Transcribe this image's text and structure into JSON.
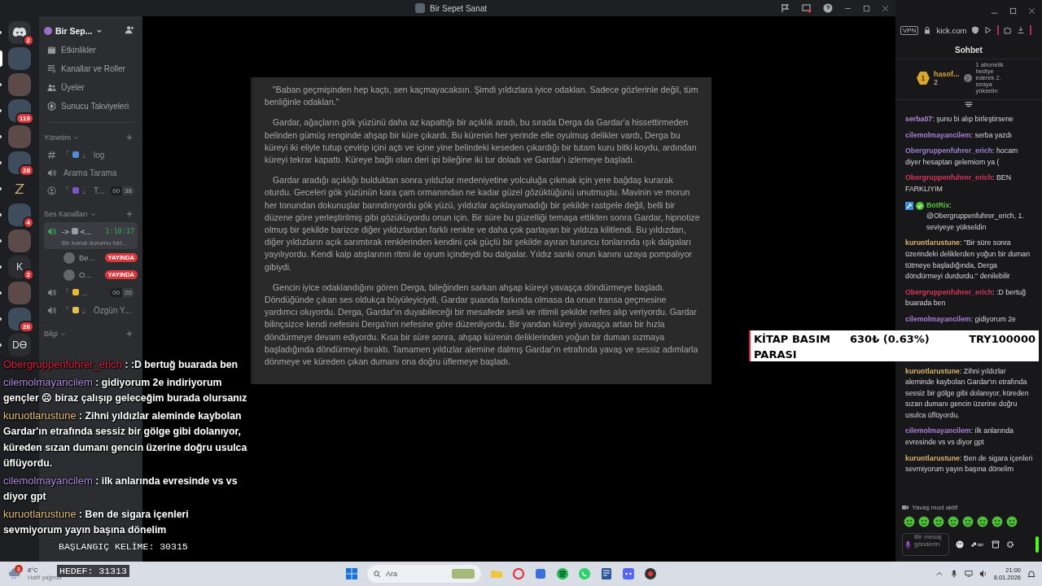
{
  "window": {
    "title": "Bir Sepet Sanat"
  },
  "rail": [
    {
      "kind": "logo",
      "badge": "2",
      "selected": false
    },
    {
      "kind": "image",
      "selected": true
    },
    {
      "kind": "image",
      "selected": false
    },
    {
      "kind": "image",
      "badge": "119",
      "selected": false
    },
    {
      "kind": "image",
      "selected": false
    },
    {
      "kind": "image",
      "badge": "28",
      "selected": false
    },
    {
      "kind": "mark",
      "selected": false
    },
    {
      "kind": "image",
      "badge": "4",
      "selected": false
    },
    {
      "kind": "image",
      "selected": false
    },
    {
      "kind": "letter",
      "text": "K",
      "badge": "2",
      "selected": false
    },
    {
      "kind": "image",
      "selected": false
    },
    {
      "kind": "image",
      "badge": "26",
      "selected": false
    },
    {
      "kind": "letter",
      "text": "DƟ",
      "selected": false
    }
  ],
  "server": {
    "name": "Bir Sep..."
  },
  "menu": [
    {
      "kind": "calendar",
      "label": "Etkinlikler"
    },
    {
      "kind": "list",
      "label": "Kanallar ve Roller"
    },
    {
      "kind": "people",
      "label": "Üyeler"
    },
    {
      "kind": "boost",
      "label": "Sunucu Takviyeleri"
    }
  ],
  "categories": [
    {
      "name": "Yönetim",
      "channels": [
        {
          "kind": "text",
          "active": false,
          "pre": "「",
          "color": "#4c8fd8",
          "post": "」",
          "label": "log"
        },
        {
          "kind": "voice",
          "active": false,
          "label": "Arama Tarama"
        },
        {
          "kind": "stage",
          "active": false,
          "pre": "「",
          "color": "#7d53c9",
          "post": "」",
          "label": "T...",
          "count": "00",
          "limit": "38"
        }
      ]
    },
    {
      "name": "Ses Kanalları",
      "channels": [
        {
          "kind": "voice",
          "active": true,
          "pre": "->",
          "color": "#9a9aa8",
          "post": "<...",
          "time": "1:10:37",
          "status": "Bir kanal durumu bel...",
          "users": [
            {
              "name": "Be...",
              "badge": "YAYINDA"
            },
            {
              "name": "O...",
              "badge": "YAYINDA"
            }
          ]
        },
        {
          "kind": "voice",
          "active": false,
          "pre": "「",
          "color": "#e9b830",
          "post": "...",
          "count": "00",
          "limit": "20"
        },
        {
          "kind": "voice",
          "active": false,
          "pre": "「",
          "color": "#e3c04f",
          "post": "」",
          "label": "Özgün Y..."
        }
      ]
    },
    {
      "name": "Bilgi"
    }
  ],
  "document": {
    "paragraphs": [
      "\"Baban geçmişinden hep kaçtı, sen kaçmayacaksın. Şimdi yıldızlara iyice odaklan. Sadece gözlerinle değil, tüm benliğinle odaklan.\"",
      "Gardar, ağaçların gök yüzünü daha az kapattığı bir açıklık aradı, bu sırada Derga da Gardar'a hissettirmeden belinden gümüş renginde ahşap bir küre çıkardı. Bu kürenin her yerinde elle oyulmuş delikler vardı, Derga bu küreyi iki eliyle tutup çevirip içini açtı ve içine yine belindeki keseden çıkardığı bir tutam kuru bitki koydu, ardından küreyi tekrar kapattı. Küreye bağlı olan deri ipi bileğine iki tur doladı ve Gardar'ı izlemeye başladı.",
      "Gardar aradığı açıklığı bulduktan sonra yıldızlar medeniyetine yolculuğa çıkmak için yere bağdaş kurarak oturdu. Geceleri gök yüzünün kara çam ormanından ne kadar güzel gözüktüğünü unutmuştu. Mavinin ve morun her tonundan dokunuşlar barındırıyordu gök yüzü, yıldızlar açıklayamadığı bir şekilde rastgele değil, belli bir düzene göre yerleştirilmiş gibi gözüküyordu onun için. Bir süre bu güzelliği temaşa ettikten sonra Gardar, hipnotize olmuş bir şekilde barizce diğer yıldızlardan farklı renkte ve daha çok parlayan bir yıldıza kilitlendi. Bu yıldızdan, diğer yıldızların açık sarımtırak renklerinden kendini çok güçlü bir şekilde ayıran turuncu tonlarında ışık dalgaları yayılıyordu. Kendi kalp atışlarının ritmi ile uyum içindeydi bu dalgalar. Yıldız sanki onun kanını uzaya pompalıyor gibiydi.",
      "Gencin iyice odaklandığını gören Derga, bileğinden sarkan ahşap küreyi yavaşça döndürmeye başladı. Döndüğünde çıkan ses oldukça büyüleyiciydi, Gardar şuanda farkında olmasa da onun transa geçmesine yardımcı oluyordu. Derga, Gardar'ın duyabileceği bir mesafede sesli ve ritimli şekilde nefes alıp veriyordu. Gardar bilinçsizce kendi nefesini Derga'nın nefesine göre düzenliyordu. Bir yandan küreyi yavaşça artan bir hızla döndürmeye devam ediyordu. Kısa bir süre sonra, ahşap kürenin deliklerinden yoğun bir duman sızmaya başladığında döndürmeyi bıraktı. Tamamen yıldızlar alemine dalmış Gardar'ın etrafında yavaş ve sessiz adımlarla dönmeye ve küreden çıkan dumanı ona doğru üflemeye başladı."
    ]
  },
  "overlay_chat": [
    {
      "user": "Obergruppenfuhrer_erich",
      "color": "#e0203c",
      "text": " : :D bertuğ buarada ben"
    },
    {
      "user": "cilemolmayancilem",
      "color": "#b08ee0",
      "text": " : gidiyorum 2e indiriyorum gençler ☹ biraz çalışıp geleceğim burada olursanız"
    },
    {
      "user": "kuruotlarustune",
      "color": "#e7c27a",
      "text": " : Zihni yıldızlar aleminde kaybolan Gardar'ın etrafında sessiz bir gölge gibi dolanıyor, küreden sızan dumanı gencin üzerine doğru usulca üflüyordu."
    },
    {
      "user": "cilemolmayancilem",
      "color": "#b08ee0",
      "text": " : ilk anlarında evresinde vs vs diyor gpt"
    },
    {
      "user": "kuruotlarustune",
      "color": "#e7c27a",
      "text": " : Ben de sigara içenleri sevmiyorum yayın başına dönelim"
    }
  ],
  "counters": {
    "start": "BAŞLANGIÇ KELİME: 30315",
    "goal": "HEDEF: 31313"
  },
  "goal_banner": {
    "title": "KİTAP BASIM PARASI",
    "amount": "630₺ (0.63%)",
    "target": "TRY100000",
    "level": 0.0063
  },
  "browser": {
    "vpn": "VPN",
    "url": "kick.com"
  },
  "chat": {
    "title": "Sohbet",
    "leader": {
      "rank": "1",
      "name": "hasof...",
      "count": "2",
      "next_rank": "2",
      "hint": "1 abonelik hediye ederek 2. sıraya yükselin"
    },
    "messages": [
      {
        "user": "serba07",
        "color": "#b48ad8",
        "bot": false,
        "text": ": şunu bi alıp birleştirsene"
      },
      {
        "user": "cilemolmayancilem",
        "color": "#a87ed6",
        "bot": false,
        "text": ": serba yazdı"
      },
      {
        "user": "Obergruppenfuhrer_erich",
        "color": "#9b7fd0",
        "bot": false,
        "text": ": hocam diyer hesaptan gelemiom ya ("
      },
      {
        "user": "Obergruppenfuhrer_erich",
        "color": "#d6365a",
        "bot": false,
        "text": ": BEN FARKLIYIM"
      },
      {
        "user": "BotRix",
        "color": "#53c53a",
        "bot": true,
        "text": ": @Obergruppenfuhrer_erich, 1. seviyeye yükseldin"
      },
      {
        "user": "kuruotlarustune",
        "color": "#d9b46b",
        "bot": false,
        "text": ": \"Bir süre sonra üzerindeki deliklerden yoğun bir duman tütmeye başladığında, Derga döndürmeyi durdurdu.\" denilebilir"
      },
      {
        "user": "Obergruppenfuhrer_erich",
        "color": "#d6365a",
        "bot": false,
        "text": ": :D bertuğ buarada ben"
      },
      {
        "user": "cilemolmayancilem",
        "color": "#a87ed6",
        "bot": false,
        "text": ": gidiyorum 2e"
      },
      {
        "user": "kuruotlarustune",
        "color": "#d9b46b",
        "bot": false,
        "text": ": Zihni yıldızlar aleminde kaybolan Gardar'ın etrafında sessiz bir gölge gibi dolanıyor, küreden sızan dumanı gencin üzerine doğru usulca üflüyordu."
      },
      {
        "user": "cilemolmayancilem",
        "color": "#a87ed6",
        "bot": false,
        "text": ": ilk anlarında evresinde vs vs diyor gpt"
      },
      {
        "user": "kuruotlarustune",
        "color": "#d9b46b",
        "bot": false,
        "text": ": Ben de sigara içenleri sevmiyorum yayın başına dönelim"
      }
    ],
    "slow_mode": "Yavaş mod aktif",
    "placeholder": "Bir mesaj gönderin"
  },
  "taskbar": {
    "weather_badge": "8",
    "temperature": "8°C",
    "weather": "Hafif yağmur",
    "search": "Ara",
    "time": "21:00",
    "date": "8.01.2026"
  }
}
